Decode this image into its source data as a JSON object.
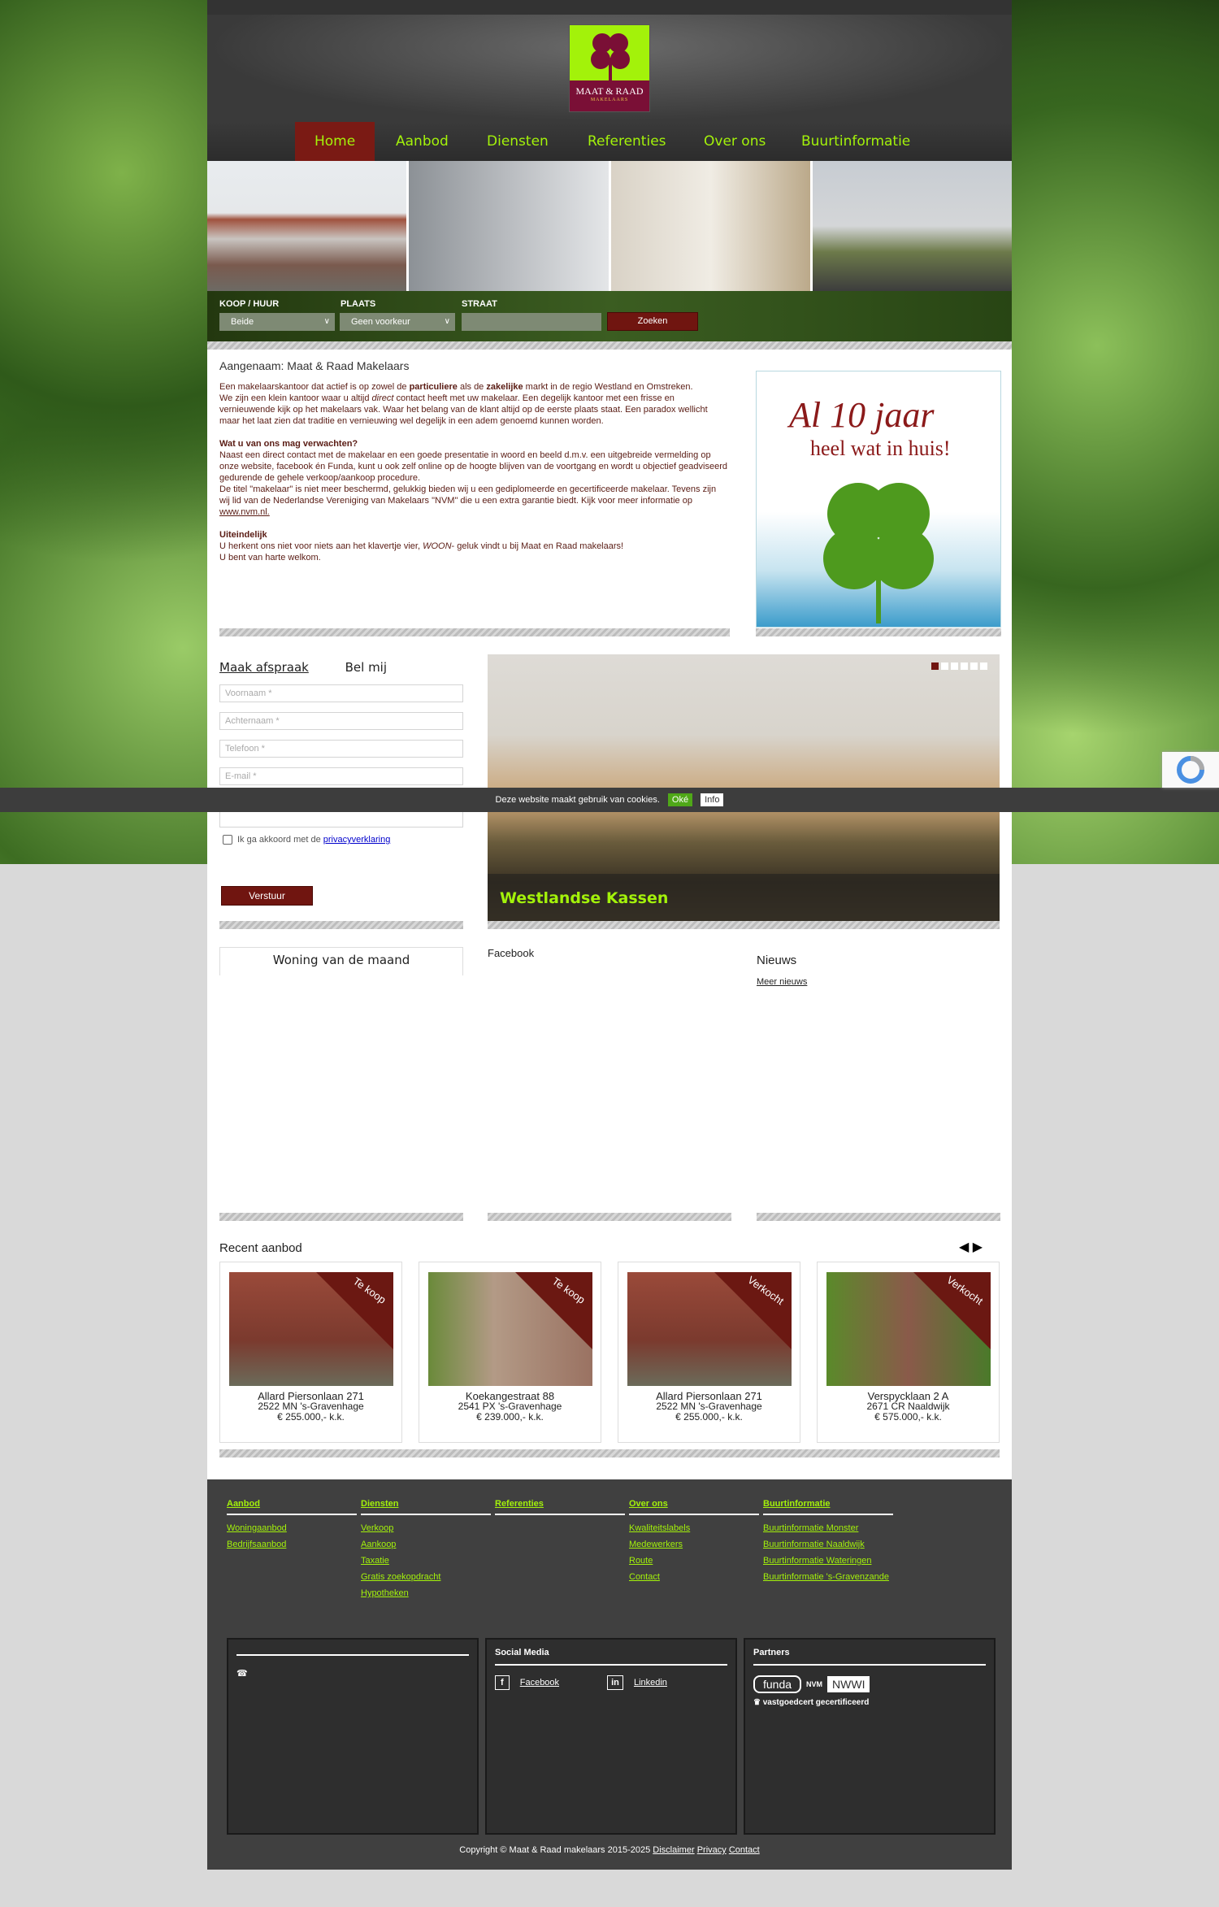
{
  "brand": {
    "logo_name": "MAAT & RAAD",
    "logo_sub": "MAKELAARS"
  },
  "nav": [
    {
      "label": "Home",
      "active": true
    },
    {
      "label": "Aanbod"
    },
    {
      "label": "Diensten"
    },
    {
      "label": "Referenties"
    },
    {
      "label": "Over ons"
    },
    {
      "label": "Buurtinformatie"
    }
  ],
  "search": {
    "type_label": "KOOP / HUUR",
    "type_value": "Beide",
    "place_label": "PLAATS",
    "place_value": "Geen voorkeur",
    "street_label": "STRAAT",
    "street_value": "",
    "submit": "Zoeken"
  },
  "intro": {
    "title": "Aangenaam: Maat & Raad Makelaars",
    "p1a": "Een makelaarskantoor dat actief is op zowel de ",
    "p1b": "particuliere",
    "p1c": " als de ",
    "p1d": "zakelijke",
    "p1e": " markt in de regio Westland en Omstreken.",
    "p1f": "We zijn een klein kantoor waar u altijd ",
    "p1g": "direct",
    "p1h": " contact heeft met uw makelaar. Een degelijk kantoor met een frisse en vernieuwende kijk op het makelaars vak. Waar het belang van de klant altijd op de eerste plaats staat. Een paradox wellicht maar het laat zien dat traditie en vernieuwing wel degelijk in een adem genoemd kunnen worden.",
    "h2": "Wat u van ons mag verwachten?",
    "p2": "Naast een direct contact met de makelaar en een goede presentatie in woord en beeld d.m.v. een uitgebreide vermelding op onze website, facebook én Funda, kunt u ook zelf online op de hoogte blijven van de voortgang en wordt u objectief geadviseerd gedurende de gehele verkoop/aankoop procedure.",
    "p3": "De titel \"makelaar\" is niet meer beschermd, gelukkig bieden wij u een gediplomeerde en gecertificeerde makelaar. Tevens zijn wij lid van de Nederlandse Vereniging van Makelaars \"NVM\" die u een extra garantie biedt. Kijk voor meer informatie op ",
    "nvm_link": "www.nvm.nl.",
    "h3": "Uiteindelijk",
    "p4a": "U herkent ons niet voor niets aan het klavertje vier, ",
    "p4b": "WOON",
    "p4c": "- geluk vindt u bij Maat en Raad makelaars!",
    "p5": "U bent van harte welkom."
  },
  "promo": {
    "line1": "Al 10 jaar",
    "line2": "heel wat in huis!"
  },
  "form": {
    "tab1": "Maak afspraak",
    "tab2": "Bel mij",
    "first": "Voornaam *",
    "last": "Achternaam *",
    "phone": "Telefoon *",
    "email": "E-mail *",
    "agree": "Ik ga akkoord met de ",
    "privacy": "privacyverklaring",
    "submit": "Verstuur"
  },
  "slider": {
    "caption": "Westlandse Kassen",
    "slides": 6,
    "active": 1
  },
  "cookie": {
    "text": "Deze website maakt gebruik van cookies.",
    "ok": "Oké",
    "info": "Info"
  },
  "widgets": {
    "woning": "Woning van de maand",
    "facebook": "Facebook",
    "news": "Nieuws",
    "more_news": "Meer nieuws"
  },
  "recent": {
    "title": "Recent aanbod",
    "items": [
      {
        "badge": "Te koop",
        "street": "Allard Piersonlaan 271",
        "city": "2522 MN 's-Gravenhage",
        "price": "€ 255.000,- k.k."
      },
      {
        "badge": "Te koop",
        "street": "Koekangestraat 88",
        "city": "2541 PX 's-Gravenhage",
        "price": "€ 239.000,- k.k."
      },
      {
        "badge": "Verkocht",
        "street": "Allard Piersonlaan 271",
        "city": "2522 MN 's-Gravenhage",
        "price": "€ 255.000,- k.k."
      },
      {
        "badge": "Verkocht",
        "street": "Verspycklaan 2 A",
        "city": "2671 CR Naaldwijk",
        "price": "€ 575.000,- k.k."
      }
    ]
  },
  "footer": {
    "cols": [
      {
        "head": "Aanbod",
        "links": [
          "Woningaanbod",
          "Bedrijfsaanbod"
        ]
      },
      {
        "head": "Diensten",
        "links": [
          "Verkoop",
          "Aankoop",
          "Taxatie",
          "Gratis zoekopdracht",
          "Hypotheken"
        ]
      },
      {
        "head": "Referenties",
        "links": []
      },
      {
        "head": "Over ons",
        "links": [
          "Kwaliteitslabels",
          "Medewerkers",
          "Route",
          "Contact"
        ]
      },
      {
        "head": "Buurtinformatie",
        "links": [
          "Buurtinformatie Monster",
          "Buurtinformatie Naaldwijk",
          "Buurtinformatie Wateringen",
          "Buurtinformatie 's-Gravenzande"
        ]
      }
    ],
    "contact": "Contact",
    "social": {
      "title": "Social Media",
      "facebook": "Facebook",
      "linkedin": "Linkedin"
    },
    "partners": {
      "title": "Partners",
      "logos": [
        "funda",
        "NVM",
        "NWWI",
        "vastgoedcert gecertificeerd"
      ]
    },
    "copyright": "Copyright © Maat & Raad makelaars 2015-2025 ",
    "disclaimer": "Disclaimer",
    "privacy": "Privacy"
  },
  "colors": {
    "accent": "#a3f20a",
    "brand_red": "#701510",
    "footer": "#404040"
  }
}
